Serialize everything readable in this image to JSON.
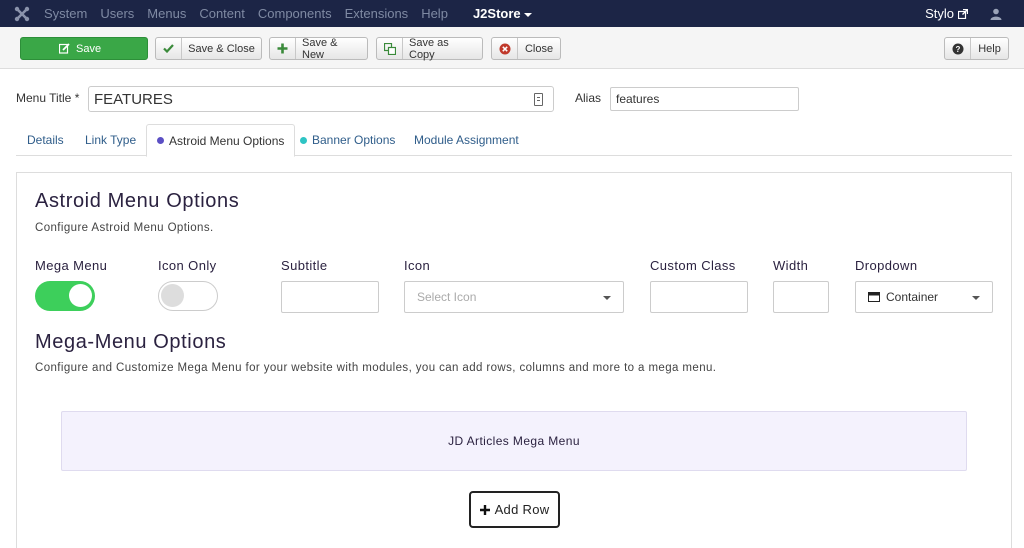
{
  "navbar": {
    "items": [
      "System",
      "Users",
      "Menus",
      "Content",
      "Components",
      "Extensions",
      "Help"
    ],
    "j2store": "J2Store",
    "user": "Stylo"
  },
  "toolbar": {
    "save": "Save",
    "save_close": "Save & Close",
    "save_new": "Save & New",
    "save_copy": "Save as Copy",
    "close": "Close",
    "help": "Help"
  },
  "form": {
    "menu_title_label": "Menu Title *",
    "menu_title_value": "FEATURES",
    "alias_label": "Alias",
    "alias_value": "features"
  },
  "tabs": [
    {
      "label": "Details"
    },
    {
      "label": "Link Type"
    },
    {
      "label": "Astroid Menu Options",
      "active": true,
      "dot": "#5b4fc4"
    },
    {
      "label": "Banner Options",
      "dot": "#2ec4c4"
    },
    {
      "label": "Module Assignment"
    }
  ],
  "astroid": {
    "title": "Astroid Menu Options",
    "description": "Configure Astroid Menu Options.",
    "mega_menu_label": "Mega Menu",
    "icon_only_label": "Icon Only",
    "subtitle_label": "Subtitle",
    "icon_label": "Icon",
    "icon_placeholder": "Select Icon",
    "custom_class_label": "Custom Class",
    "width_label": "Width",
    "dropdown_label": "Dropdown",
    "dropdown_value": "Container",
    "mega_menu_on": true,
    "icon_only_on": false
  },
  "mega": {
    "title": "Mega-Menu Options",
    "description": "Configure and Customize Mega Menu for your website with modules, you can add rows, columns and more to a mega menu.",
    "item": "JD Articles Mega Menu",
    "add_row": "Add Row"
  },
  "colors": {
    "navbar": "#1c2546",
    "save": "#3aa747",
    "toggle_on": "#3dcf5b",
    "mega_box": "#f4f2fd"
  }
}
